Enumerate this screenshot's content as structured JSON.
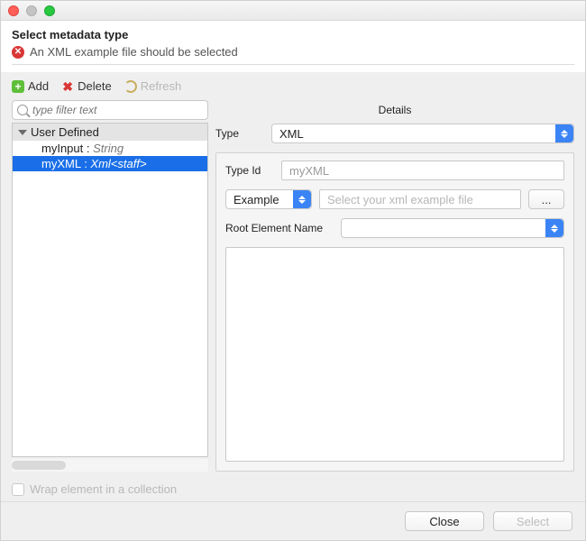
{
  "header": {
    "title": "Select metadata type",
    "error_msg": "An XML example file should be selected"
  },
  "toolbar": {
    "add_label": "Add",
    "delete_label": "Delete",
    "refresh_label": "Refresh"
  },
  "search": {
    "placeholder": "type filter text"
  },
  "tree": {
    "group": "User Defined",
    "items": [
      {
        "name": "myInput",
        "type": "String",
        "selected": false
      },
      {
        "name": "myXML",
        "type": "Xml<staff>",
        "selected": true
      }
    ]
  },
  "details": {
    "title": "Details",
    "type_label": "Type",
    "type_value": "XML",
    "typeid_label": "Type Id",
    "typeid_value": "myXML",
    "source_select": "Example",
    "source_placeholder": "Select your xml example file",
    "browse_label": "...",
    "root_label": "Root Element Name",
    "root_value": ""
  },
  "wrap": {
    "label": "Wrap element in a collection",
    "checked": false
  },
  "footer": {
    "close_label": "Close",
    "select_label": "Select"
  }
}
